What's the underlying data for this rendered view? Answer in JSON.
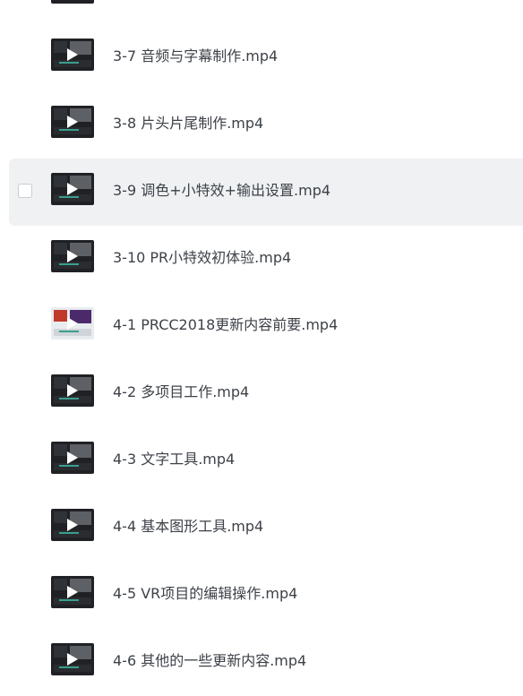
{
  "files": [
    {
      "name": "",
      "thumbnail": "video-thumbnail-dark"
    },
    {
      "name": "3-7 音频与字幕制作.mp4",
      "thumbnail": "video-thumbnail-dark"
    },
    {
      "name": "3-8 片头片尾制作.mp4",
      "thumbnail": "video-thumbnail-dark"
    },
    {
      "name": "3-9 调色+小特效+输出设置.mp4",
      "thumbnail": "video-thumbnail-dark",
      "hovered": true
    },
    {
      "name": "3-10 PR小特效初体验.mp4",
      "thumbnail": "video-thumbnail-dark"
    },
    {
      "name": "4-1 PRCC2018更新内容前要.mp4",
      "thumbnail": "video-thumbnail-light"
    },
    {
      "name": "4-2 多项目工作.mp4",
      "thumbnail": "video-thumbnail-dark"
    },
    {
      "name": "4-3 文字工具.mp4",
      "thumbnail": "video-thumbnail-dark"
    },
    {
      "name": "4-4 基本图形工具.mp4",
      "thumbnail": "video-thumbnail-dark"
    },
    {
      "name": "4-5 VR项目的编辑操作.mp4",
      "thumbnail": "video-thumbnail-dark"
    },
    {
      "name": "4-6 其他的一些更新内容.mp4",
      "thumbnail": "video-thumbnail-dark"
    }
  ],
  "colors": {
    "hover_background": "#eff1f3",
    "text": "#3d4248",
    "thumbnail_dark": "#1f2125",
    "accent_timeline": "#3a9f8f"
  }
}
